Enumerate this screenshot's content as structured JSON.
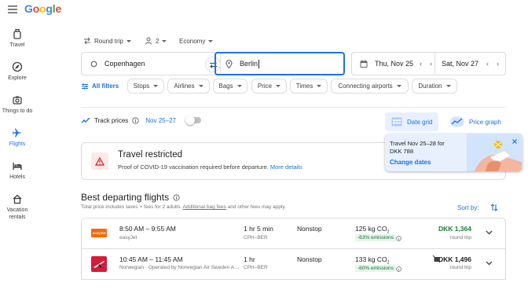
{
  "brand": {
    "letters": [
      "G",
      "o",
      "o",
      "g",
      "l",
      "e"
    ],
    "colors": [
      "#4285f4",
      "#ea4335",
      "#fbbc05",
      "#4285f4",
      "#34a853",
      "#ea4335"
    ]
  },
  "sidebar": {
    "items": [
      {
        "label": "Travel",
        "icon": "suitcase-icon"
      },
      {
        "label": "Explore",
        "icon": "explore-icon"
      },
      {
        "label": "Things to do",
        "icon": "camera-icon"
      },
      {
        "label": "Flights",
        "icon": "plane-icon"
      },
      {
        "label": "Hotels",
        "icon": "bed-icon"
      },
      {
        "label": "Vacation rentals",
        "icon": "house-icon"
      }
    ],
    "active": "Flights"
  },
  "trip": {
    "type": "Round trip",
    "passengers": "2",
    "class": "Economy"
  },
  "search": {
    "from": "Copenhagen",
    "to": "Berlin",
    "depart": "Thu, Nov 25",
    "return": "Sat, Nov 27"
  },
  "filters": {
    "all": "All filters",
    "chips": [
      "Stops",
      "Airlines",
      "Bags",
      "Price",
      "Times",
      "Connecting airports",
      "Duration"
    ]
  },
  "track": {
    "label": "Track prices",
    "dates": "Nov 25–27"
  },
  "views": {
    "date_grid": "Date grid",
    "price_graph": "Price graph"
  },
  "restricted": {
    "title": "Travel restricted",
    "text": "Proof of COVID-19 vaccination required before departure.",
    "link": "More details"
  },
  "tooltip": {
    "line1": "Travel Nov 25–28 for",
    "line2": "DKK 788",
    "link": "Change dates"
  },
  "results": {
    "heading": "Best departing flights",
    "note_pre": "Total price includes taxes + fees for 2 adults.",
    "note_link": "Additional bag fees",
    "note_post": "and other fees may apply.",
    "sort_label": "Sort by:",
    "flights": [
      {
        "times": "8:50 AM – 9:55 AM",
        "airline": "easyJet",
        "duration": "1 hr 5 min",
        "route": "CPH–BER",
        "stops": "Nonstop",
        "co2": "125 kg CO",
        "emissions": "-63% emissions",
        "price": "DKK 1,364",
        "price_type": "round trip",
        "price_color": "#188038"
      },
      {
        "times": "10:45 AM – 11:45 AM",
        "airline": "Norwegian · Operated by Norwegian Air Sweden A…",
        "duration": "1 hr",
        "route": "CPH–BER",
        "stops": "Nonstop",
        "co2": "133 kg CO",
        "emissions": "-60% emissions",
        "price": "DKK 1,496",
        "price_type": "round trip",
        "price_color": "#202124"
      }
    ]
  }
}
